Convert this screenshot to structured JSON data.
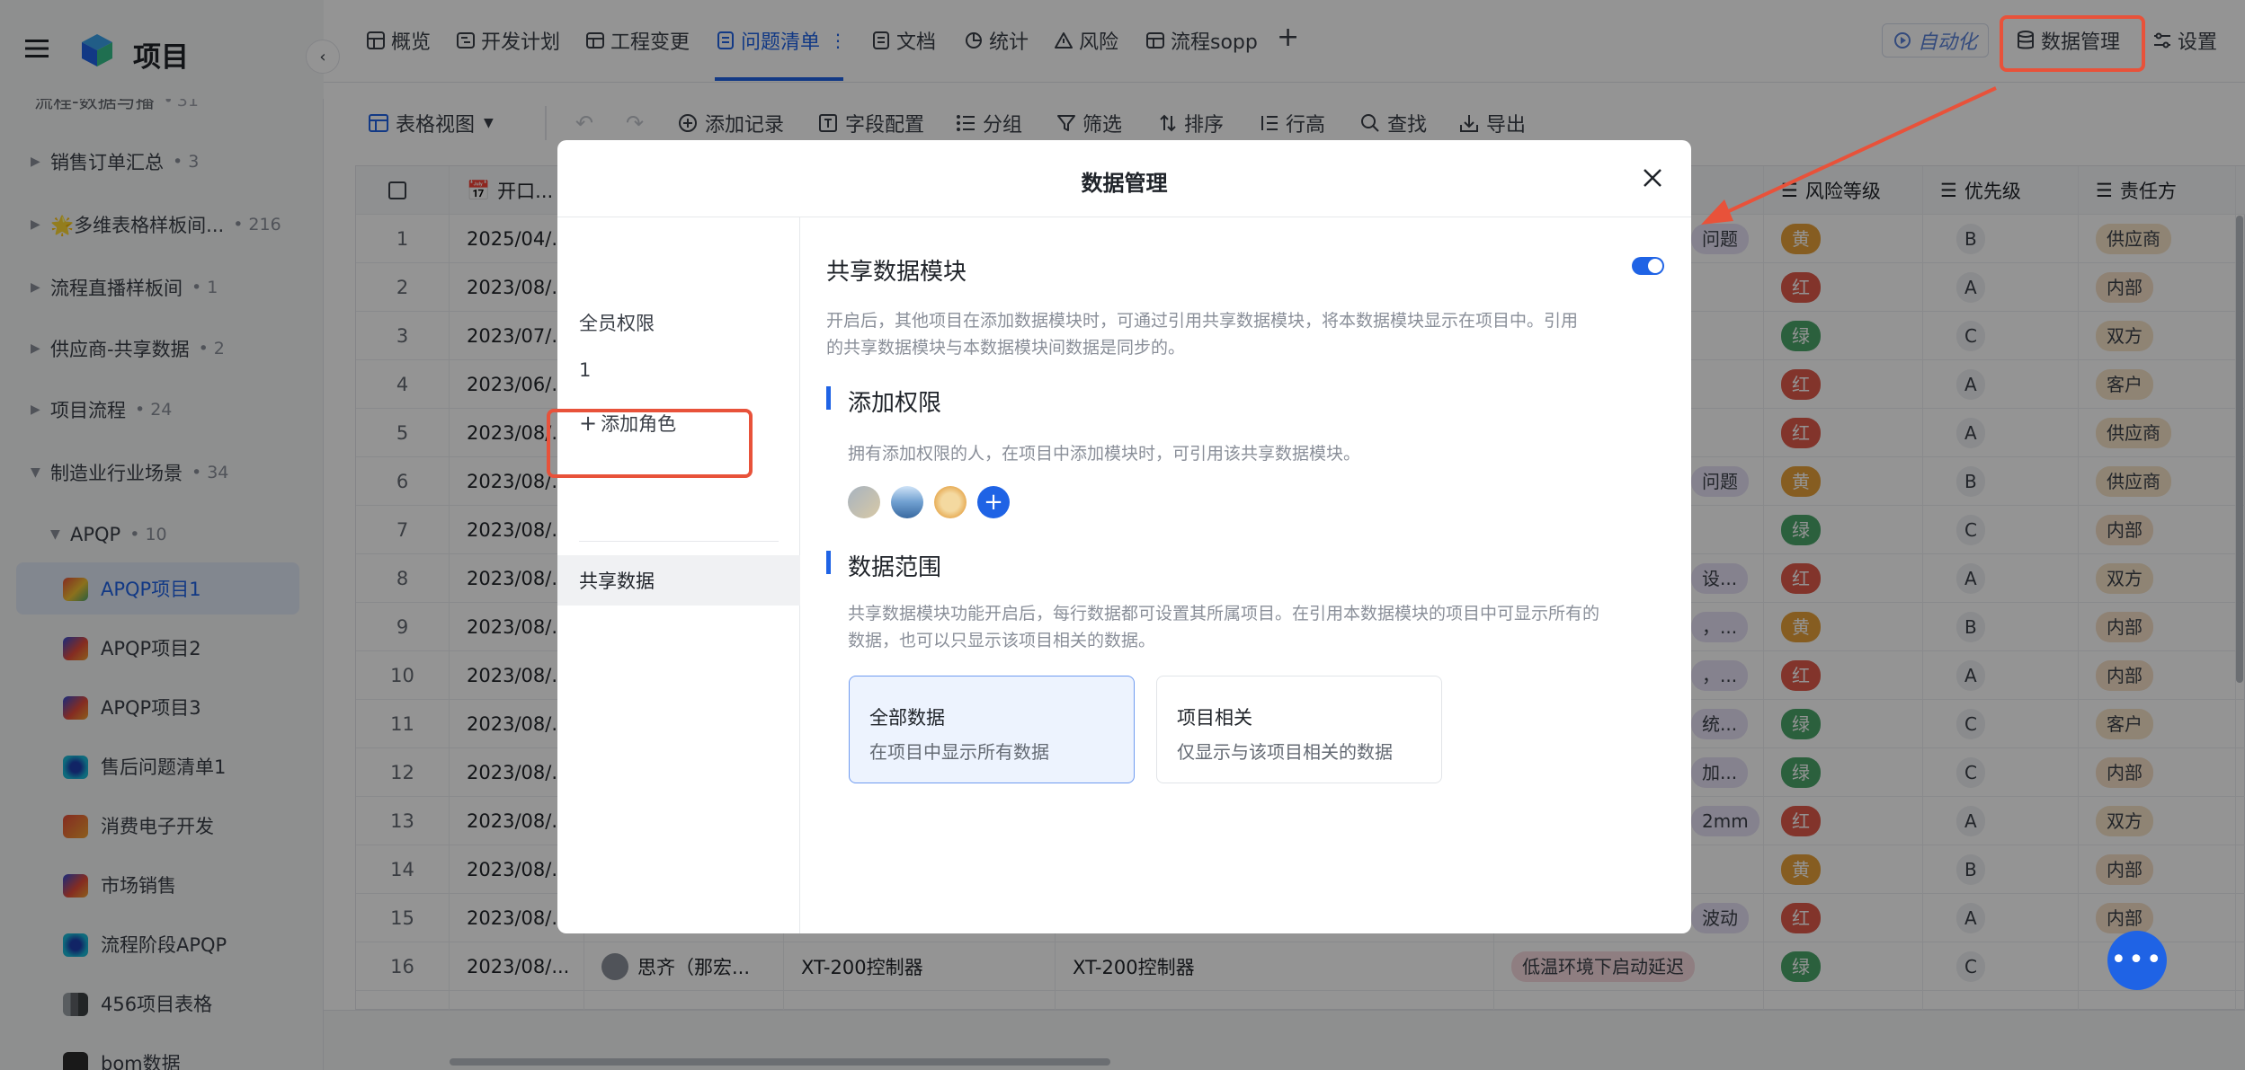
{
  "app": {
    "title": "项目"
  },
  "sidebar": {
    "top_partial": {
      "label": "流程-数据与播",
      "count": "31"
    },
    "groups": [
      {
        "label": "销售订单汇总",
        "count": "3"
      },
      {
        "label": "🌟多维表格样板间...",
        "count": "216"
      },
      {
        "label": "流程直播样板间",
        "count": "1"
      },
      {
        "label": "供应商-共享数据",
        "count": "2"
      },
      {
        "label": "项目流程",
        "count": "24"
      },
      {
        "label": "制造业行业场景",
        "count": "34"
      }
    ],
    "subgroup": {
      "label": "APQP",
      "count": "10"
    },
    "projects": [
      "APQP项目1",
      "APQP项目2",
      "APQP项目3",
      "售后问题清单1",
      "消费电子开发",
      "市场销售",
      "流程阶段APQP",
      "456项目表格",
      "bom数据"
    ]
  },
  "tabs": [
    "概览",
    "开发计划",
    "工程变更",
    "问题清单",
    "文档",
    "统计",
    "风险",
    "流程sopp"
  ],
  "tab_more": "⋮",
  "tab_add": "+",
  "top_actions": {
    "automation": "自动化",
    "data_management": "数据管理",
    "settings": "设置"
  },
  "toolbar": {
    "view": "表格视图",
    "add_record": "添加记录",
    "field_config": "字段配置",
    "group": "分组",
    "filter": "筛选",
    "sort": "排序",
    "row_height": "行高",
    "find": "查找",
    "export": "导出"
  },
  "table": {
    "headers": {
      "open_date": "开口...",
      "risk_level": "风险等级",
      "priority": "优先级",
      "owner": "责任方"
    },
    "rows": [
      {
        "n": "1",
        "date": "2025/04/...",
        "issue": "问题",
        "risk": "黄",
        "priority": "B",
        "owner": "供应商"
      },
      {
        "n": "2",
        "date": "2023/08/...",
        "issue": "",
        "risk": "红",
        "priority": "A",
        "owner": "内部"
      },
      {
        "n": "3",
        "date": "2023/07/...",
        "issue": "",
        "risk": "绿",
        "priority": "C",
        "owner": "双方"
      },
      {
        "n": "4",
        "date": "2023/06/...",
        "issue": "",
        "risk": "红",
        "priority": "A",
        "owner": "客户"
      },
      {
        "n": "5",
        "date": "2023/08/...",
        "issue": "",
        "risk": "红",
        "priority": "A",
        "owner": "供应商"
      },
      {
        "n": "6",
        "date": "2023/08/...",
        "issue": "问题",
        "risk": "黄",
        "priority": "B",
        "owner": "供应商"
      },
      {
        "n": "7",
        "date": "2023/08/...",
        "issue": "",
        "risk": "绿",
        "priority": "C",
        "owner": "内部"
      },
      {
        "n": "8",
        "date": "2023/08/...",
        "issue": "设...",
        "risk": "红",
        "priority": "A",
        "owner": "双方"
      },
      {
        "n": "9",
        "date": "2023/08/...",
        "issue": "，...",
        "risk": "黄",
        "priority": "B",
        "owner": "内部"
      },
      {
        "n": "10",
        "date": "2023/08/...",
        "issue": "，...",
        "risk": "红",
        "priority": "A",
        "owner": "内部"
      },
      {
        "n": "11",
        "date": "2023/08/...",
        "issue": "统...",
        "risk": "绿",
        "priority": "C",
        "owner": "客户"
      },
      {
        "n": "12",
        "date": "2023/08/...",
        "issue": "加...",
        "risk": "绿",
        "priority": "C",
        "owner": "内部"
      },
      {
        "n": "13",
        "date": "2023/08/...",
        "issue": "2mm",
        "risk": "红",
        "priority": "A",
        "owner": "双方"
      },
      {
        "n": "14",
        "date": "2023/08/...",
        "issue": "",
        "risk": "黄",
        "priority": "B",
        "owner": "内部"
      },
      {
        "n": "15",
        "date": "2023/08/...",
        "issue": "波动",
        "risk": "红",
        "priority": "A",
        "owner": "内部"
      },
      {
        "n": "16",
        "date": "2023/08/...",
        "person": "思齐（那宏...",
        "product": "XT-200控制器",
        "product2": "XT-200控制器",
        "issue": "低温环境下启动延迟",
        "risk": "绿",
        "priority": "C",
        "owner": ""
      }
    ]
  },
  "modal": {
    "title": "数据管理",
    "left": {
      "all_perm": "全员权限",
      "role1": "1",
      "add_role": "添加角色",
      "shared": "共享数据"
    },
    "section_title": "共享数据模块",
    "section_desc_1": "开启后，其他项目在添加数据模块时，可通过引用共享数据模块，将本数据模块显示在项目中。引用",
    "section_desc_2": "的共享数据模块与本数据模块间数据是同步的。",
    "add_perm_title": "添加权限",
    "add_perm_desc": "拥有添加权限的人，在项目中添加模块时，可引用该共享数据模块。",
    "scope_title": "数据范围",
    "scope_desc_1": "共享数据模块功能开启后，每行数据都可设置其所属项目。在引用本数据模块的项目中可显示所有的",
    "scope_desc_2": "数据，也可以只显示该项目相关的数据。",
    "option_all": {
      "title": "全部数据",
      "desc": "在项目中显示所有数据"
    },
    "option_related": {
      "title": "项目相关",
      "desc": "仅显示与该项目相关的数据"
    },
    "toggle_on": true
  },
  "colors": {
    "accent": "#1f63e5",
    "red": "#e05a4a",
    "yellow": "#e7a13a",
    "green": "#4aa56a",
    "annotation": "#e8523a"
  }
}
